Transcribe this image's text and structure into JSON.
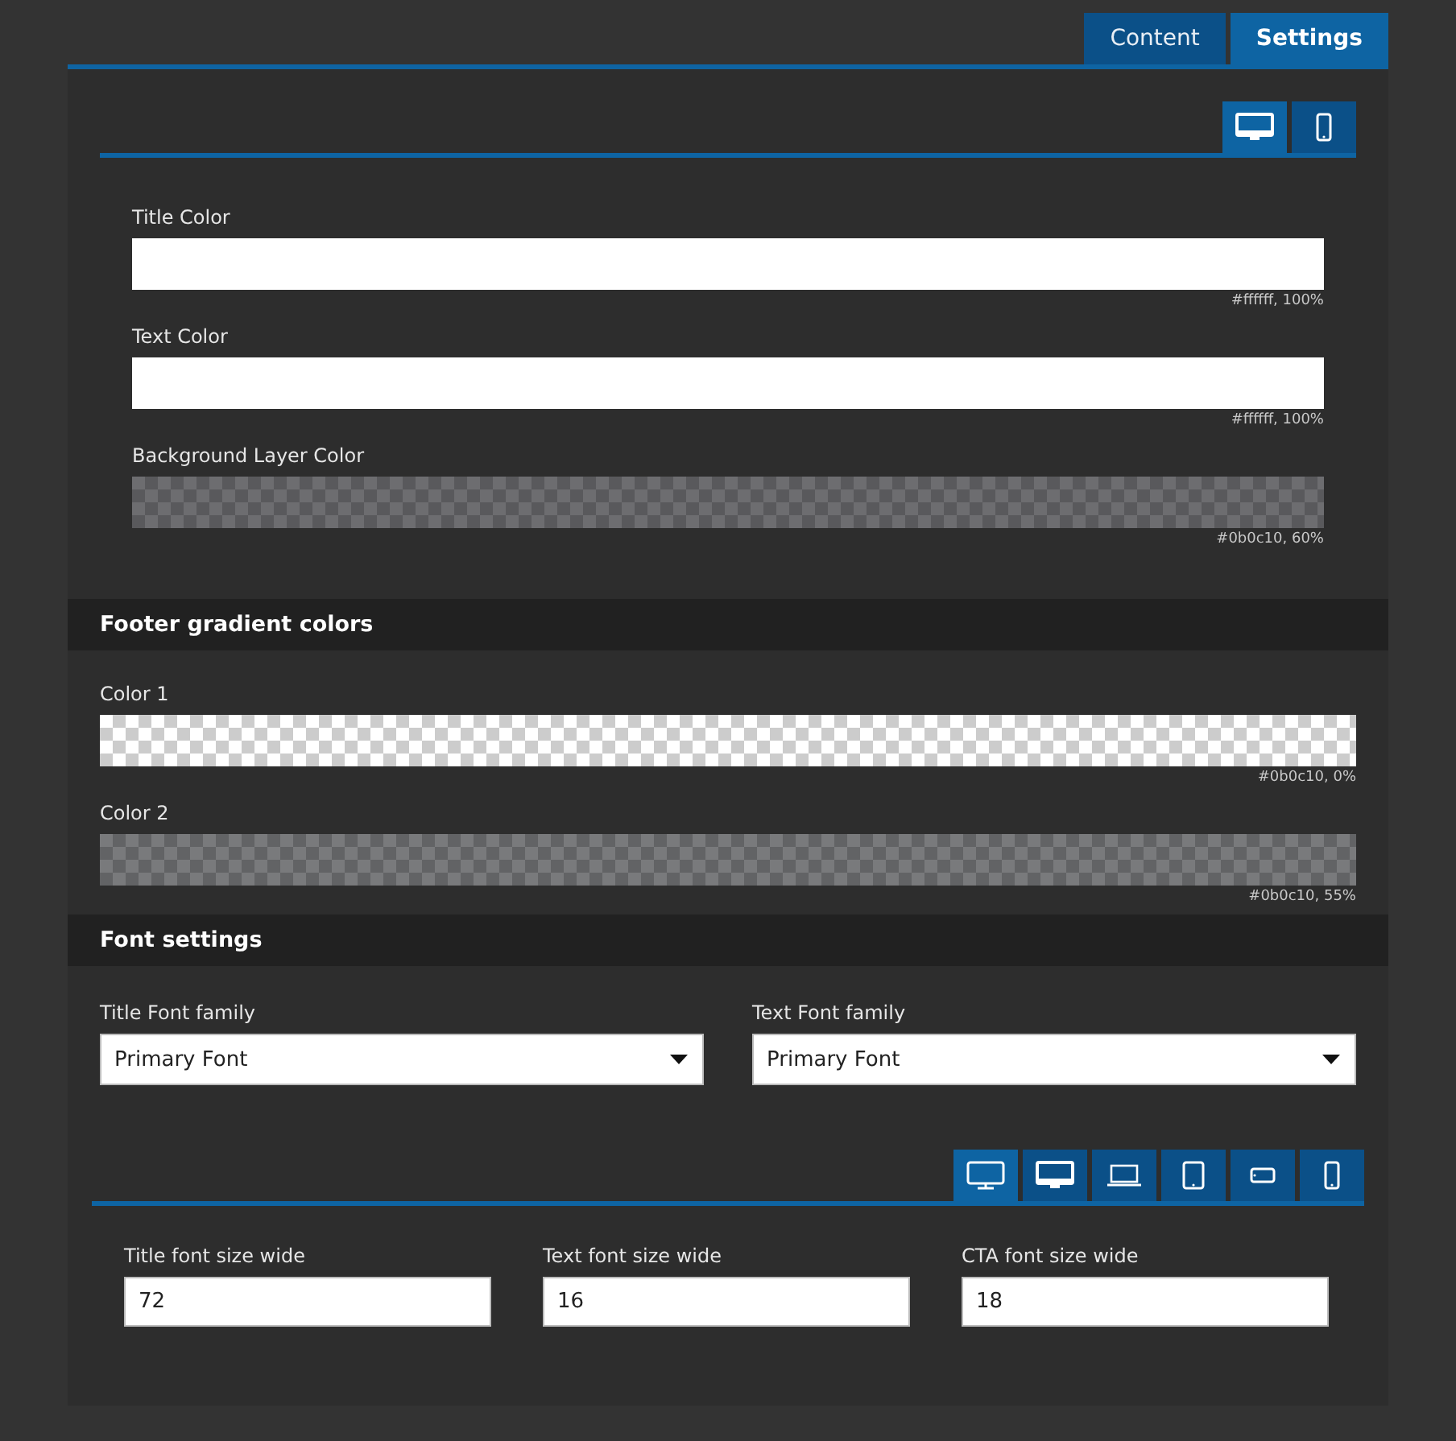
{
  "tabs": [
    {
      "label": "Content",
      "selected": false
    },
    {
      "label": "Settings",
      "selected": true
    }
  ],
  "device_bar": [
    {
      "kind": "imac",
      "selected": true
    },
    {
      "kind": "phone",
      "selected": false
    }
  ],
  "colors": [
    {
      "label": "Title Color",
      "reading": "#ffffff, 100%"
    },
    {
      "label": "Text Color",
      "reading": "#ffffff, 100%"
    },
    {
      "label": "Background Layer Color",
      "reading": "#0b0c10, 60%"
    }
  ],
  "footer_section": {
    "title": "Footer gradient colors",
    "colors": [
      {
        "label": "Color 1",
        "reading": "#0b0c10, 0%"
      },
      {
        "label": "Color 2",
        "reading": "#0b0c10, 55%"
      }
    ]
  },
  "font_section": {
    "title": "Font settings",
    "selects": [
      {
        "label": "Title Font family",
        "value": "Primary Font"
      },
      {
        "label": "Text Font family",
        "value": "Primary Font"
      }
    ],
    "device_bar": [
      {
        "kind": "monitor",
        "selected": true
      },
      {
        "kind": "imac",
        "selected": false
      },
      {
        "kind": "laptop",
        "selected": false
      },
      {
        "kind": "tablet",
        "selected": false
      },
      {
        "kind": "phone-landscape",
        "selected": false
      },
      {
        "kind": "phone",
        "selected": false
      }
    ],
    "sizes": [
      {
        "label": "Title font size wide",
        "value": "72"
      },
      {
        "label": "Text font size wide",
        "value": "16"
      },
      {
        "label": "CTA font size wide",
        "value": "18"
      }
    ]
  }
}
